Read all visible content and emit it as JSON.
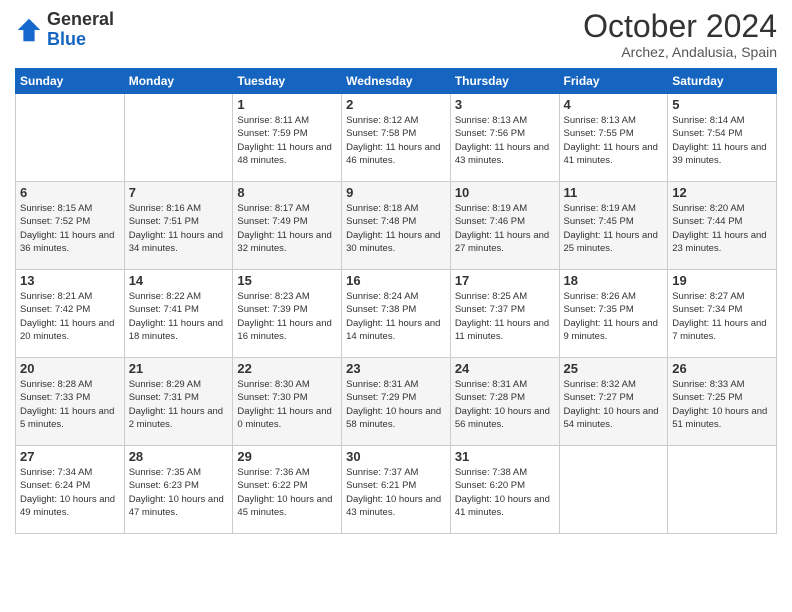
{
  "header": {
    "logo": {
      "general": "General",
      "blue": "Blue"
    },
    "title": "October 2024",
    "location": "Archez, Andalusia, Spain"
  },
  "calendar": {
    "days_of_week": [
      "Sunday",
      "Monday",
      "Tuesday",
      "Wednesday",
      "Thursday",
      "Friday",
      "Saturday"
    ],
    "weeks": [
      [
        {
          "day": "",
          "info": ""
        },
        {
          "day": "",
          "info": ""
        },
        {
          "day": "1",
          "info": "Sunrise: 8:11 AM\nSunset: 7:59 PM\nDaylight: 11 hours and 48 minutes."
        },
        {
          "day": "2",
          "info": "Sunrise: 8:12 AM\nSunset: 7:58 PM\nDaylight: 11 hours and 46 minutes."
        },
        {
          "day": "3",
          "info": "Sunrise: 8:13 AM\nSunset: 7:56 PM\nDaylight: 11 hours and 43 minutes."
        },
        {
          "day": "4",
          "info": "Sunrise: 8:13 AM\nSunset: 7:55 PM\nDaylight: 11 hours and 41 minutes."
        },
        {
          "day": "5",
          "info": "Sunrise: 8:14 AM\nSunset: 7:54 PM\nDaylight: 11 hours and 39 minutes."
        }
      ],
      [
        {
          "day": "6",
          "info": "Sunrise: 8:15 AM\nSunset: 7:52 PM\nDaylight: 11 hours and 36 minutes."
        },
        {
          "day": "7",
          "info": "Sunrise: 8:16 AM\nSunset: 7:51 PM\nDaylight: 11 hours and 34 minutes."
        },
        {
          "day": "8",
          "info": "Sunrise: 8:17 AM\nSunset: 7:49 PM\nDaylight: 11 hours and 32 minutes."
        },
        {
          "day": "9",
          "info": "Sunrise: 8:18 AM\nSunset: 7:48 PM\nDaylight: 11 hours and 30 minutes."
        },
        {
          "day": "10",
          "info": "Sunrise: 8:19 AM\nSunset: 7:46 PM\nDaylight: 11 hours and 27 minutes."
        },
        {
          "day": "11",
          "info": "Sunrise: 8:19 AM\nSunset: 7:45 PM\nDaylight: 11 hours and 25 minutes."
        },
        {
          "day": "12",
          "info": "Sunrise: 8:20 AM\nSunset: 7:44 PM\nDaylight: 11 hours and 23 minutes."
        }
      ],
      [
        {
          "day": "13",
          "info": "Sunrise: 8:21 AM\nSunset: 7:42 PM\nDaylight: 11 hours and 20 minutes."
        },
        {
          "day": "14",
          "info": "Sunrise: 8:22 AM\nSunset: 7:41 PM\nDaylight: 11 hours and 18 minutes."
        },
        {
          "day": "15",
          "info": "Sunrise: 8:23 AM\nSunset: 7:39 PM\nDaylight: 11 hours and 16 minutes."
        },
        {
          "day": "16",
          "info": "Sunrise: 8:24 AM\nSunset: 7:38 PM\nDaylight: 11 hours and 14 minutes."
        },
        {
          "day": "17",
          "info": "Sunrise: 8:25 AM\nSunset: 7:37 PM\nDaylight: 11 hours and 11 minutes."
        },
        {
          "day": "18",
          "info": "Sunrise: 8:26 AM\nSunset: 7:35 PM\nDaylight: 11 hours and 9 minutes."
        },
        {
          "day": "19",
          "info": "Sunrise: 8:27 AM\nSunset: 7:34 PM\nDaylight: 11 hours and 7 minutes."
        }
      ],
      [
        {
          "day": "20",
          "info": "Sunrise: 8:28 AM\nSunset: 7:33 PM\nDaylight: 11 hours and 5 minutes."
        },
        {
          "day": "21",
          "info": "Sunrise: 8:29 AM\nSunset: 7:31 PM\nDaylight: 11 hours and 2 minutes."
        },
        {
          "day": "22",
          "info": "Sunrise: 8:30 AM\nSunset: 7:30 PM\nDaylight: 11 hours and 0 minutes."
        },
        {
          "day": "23",
          "info": "Sunrise: 8:31 AM\nSunset: 7:29 PM\nDaylight: 10 hours and 58 minutes."
        },
        {
          "day": "24",
          "info": "Sunrise: 8:31 AM\nSunset: 7:28 PM\nDaylight: 10 hours and 56 minutes."
        },
        {
          "day": "25",
          "info": "Sunrise: 8:32 AM\nSunset: 7:27 PM\nDaylight: 10 hours and 54 minutes."
        },
        {
          "day": "26",
          "info": "Sunrise: 8:33 AM\nSunset: 7:25 PM\nDaylight: 10 hours and 51 minutes."
        }
      ],
      [
        {
          "day": "27",
          "info": "Sunrise: 7:34 AM\nSunset: 6:24 PM\nDaylight: 10 hours and 49 minutes."
        },
        {
          "day": "28",
          "info": "Sunrise: 7:35 AM\nSunset: 6:23 PM\nDaylight: 10 hours and 47 minutes."
        },
        {
          "day": "29",
          "info": "Sunrise: 7:36 AM\nSunset: 6:22 PM\nDaylight: 10 hours and 45 minutes."
        },
        {
          "day": "30",
          "info": "Sunrise: 7:37 AM\nSunset: 6:21 PM\nDaylight: 10 hours and 43 minutes."
        },
        {
          "day": "31",
          "info": "Sunrise: 7:38 AM\nSunset: 6:20 PM\nDaylight: 10 hours and 41 minutes."
        },
        {
          "day": "",
          "info": ""
        },
        {
          "day": "",
          "info": ""
        }
      ]
    ]
  }
}
